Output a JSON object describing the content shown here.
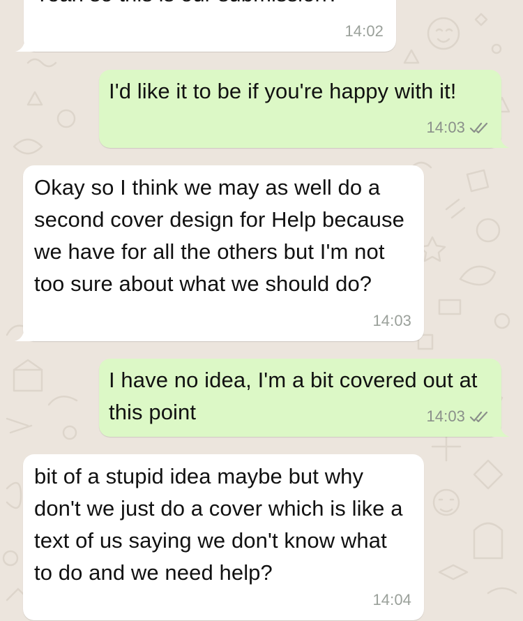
{
  "messages": [
    {
      "direction": "incoming",
      "text": "Yeah so this is our submission?",
      "time": "14:02"
    },
    {
      "direction": "outgoing",
      "text": "I'd like it to be if you're happy with it!",
      "time": "14:03",
      "status": "read-double-check-icon"
    },
    {
      "direction": "incoming",
      "text": "Okay so I think we may as well do a second cover design for Help because we have for all the others but I'm not too sure about what we should do?",
      "time": "14:03"
    },
    {
      "direction": "outgoing",
      "text": "I have no idea, I'm a bit covered out at this point",
      "time": "14:03",
      "status": "read-double-check-icon"
    },
    {
      "direction": "incoming",
      "text": "bit of a stupid idea maybe but why don't we just do a cover which is like a text of us saying we don't know what to do and we need help?",
      "time": "14:04"
    }
  ],
  "colors": {
    "background": "#ece5dd",
    "incoming_bubble": "#ffffff",
    "outgoing_bubble": "#dcf8c6",
    "timestamp": "#8a8f8a",
    "check_marks": "#8a8f8a"
  }
}
